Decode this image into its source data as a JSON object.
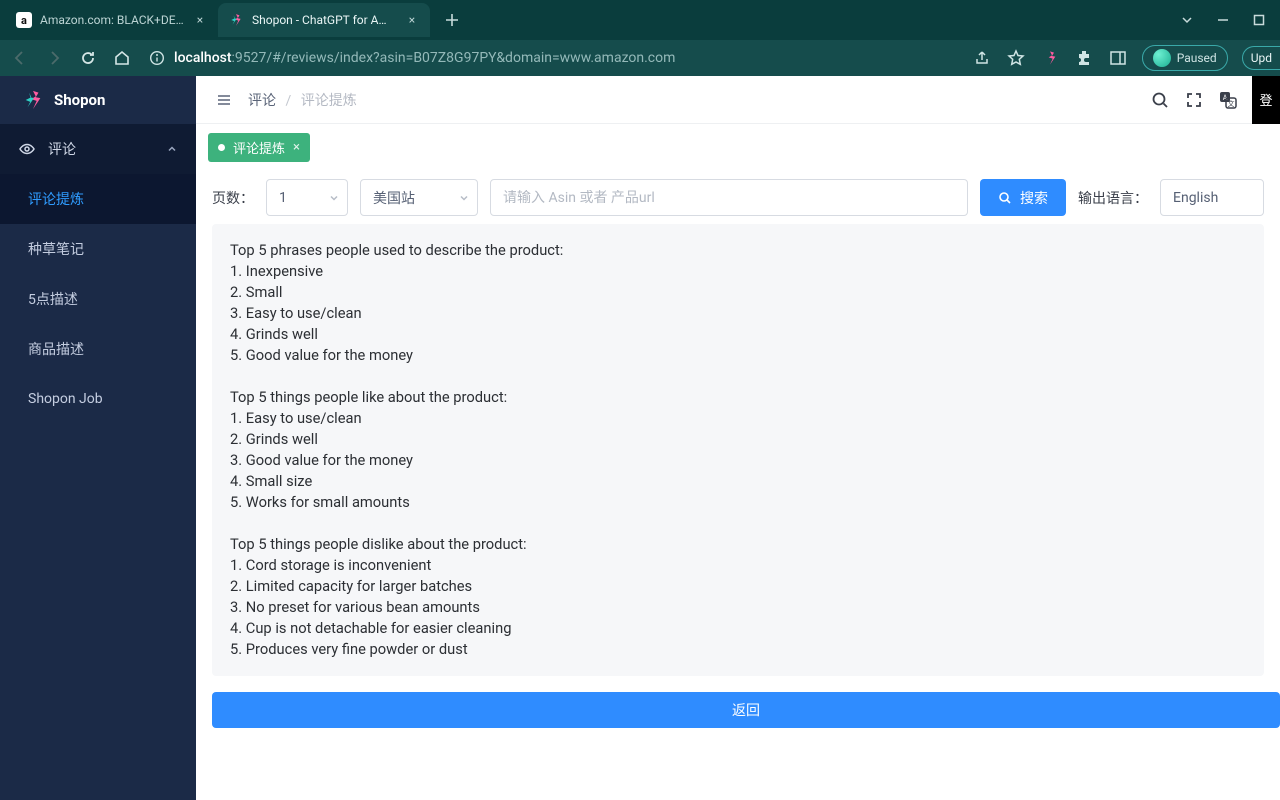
{
  "browser": {
    "tabs": [
      {
        "title": "Amazon.com: BLACK+DECKER"
      },
      {
        "title": "Shopon - ChatGPT for Amazon"
      }
    ],
    "url_host": "localhost",
    "url_rest": ":9527/#/reviews/index?asin=B07Z8G97PY&domain=www.amazon.com",
    "paused_label": "Paused",
    "update_label": "Upd"
  },
  "sidebar": {
    "brand": "Shopon",
    "group_label": "评论",
    "items": [
      "评论提炼",
      "种草笔记",
      "5点描述",
      "商品描述",
      "Shopon Job"
    ]
  },
  "topbar": {
    "crumb_root": "评论",
    "crumb_current": "评论提炼",
    "badge": "登"
  },
  "tag": {
    "label": "评论提炼",
    "close": "×"
  },
  "toolbar": {
    "page_label": "页数：",
    "page_value": "1",
    "site_value": "美国站",
    "search_placeholder": "请输入 Asin 或者 产品url",
    "search_btn": "搜索",
    "lang_label": "输出语言：",
    "lang_value": "English"
  },
  "content": {
    "sections": [
      {
        "heading": "Top 5 phrases people used to describe the product:",
        "items": [
          "1. Inexpensive",
          "2. Small",
          "3. Easy to use/clean",
          "4. Grinds well",
          "5. Good value for the money"
        ]
      },
      {
        "heading": "Top 5 things people like about the product:",
        "items": [
          "1. Easy to use/clean",
          "2. Grinds well",
          "3. Good value for the money",
          "4. Small size",
          "5. Works for small amounts"
        ]
      },
      {
        "heading": "Top 5 things people dislike about the product:",
        "items": [
          "1. Cord storage is inconvenient",
          "2. Limited capacity for larger batches",
          "3. No preset for various bean amounts",
          "4. Cup is not detachable for easier cleaning",
          "5. Produces very fine powder or dust"
        ]
      }
    ]
  },
  "back_btn": "返回"
}
